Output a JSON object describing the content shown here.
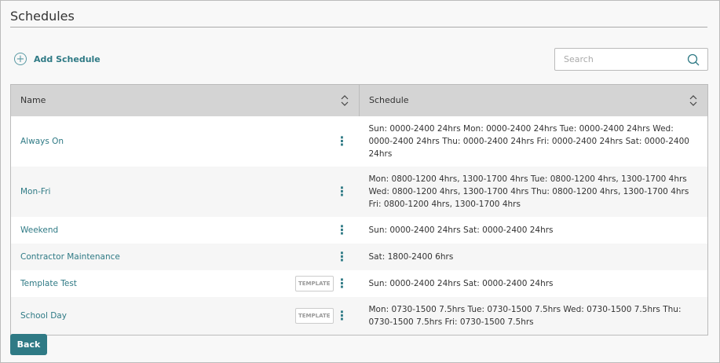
{
  "page": {
    "title": "Schedules"
  },
  "toolbar": {
    "add_label": "Add Schedule",
    "search_placeholder": "Search"
  },
  "table": {
    "headers": {
      "name": "Name",
      "schedule": "Schedule"
    },
    "template_badge": "TEMPLATE",
    "rows": [
      {
        "name": "Always On",
        "template": false,
        "schedule": "Sun: 0000-2400 24hrs Mon: 0000-2400 24hrs Tue: 0000-2400 24hrs Wed: 0000-2400 24hrs Thu: 0000-2400 24hrs Fri: 0000-2400 24hrs Sat: 0000-2400 24hrs"
      },
      {
        "name": "Mon-Fri",
        "template": false,
        "schedule": "Mon: 0800-1200 4hrs, 1300-1700 4hrs Tue: 0800-1200 4hrs, 1300-1700 4hrs Wed: 0800-1200 4hrs, 1300-1700 4hrs Thu: 0800-1200 4hrs, 1300-1700 4hrs Fri: 0800-1200 4hrs, 1300-1700 4hrs"
      },
      {
        "name": "Weekend",
        "template": false,
        "schedule": "Sun: 0000-2400 24hrs Sat: 0000-2400 24hrs"
      },
      {
        "name": "Contractor Maintenance",
        "template": false,
        "schedule": "Sat: 1800-2400 6hrs"
      },
      {
        "name": "Template Test",
        "template": true,
        "schedule": "Sun: 0000-2400 24hrs Sat: 0000-2400 24hrs"
      },
      {
        "name": "School Day",
        "template": true,
        "schedule": "Mon: 0730-1500 7.5hrs Tue: 0730-1500 7.5hrs Wed: 0730-1500 7.5hrs Thu: 0730-1500 7.5hrs Fri: 0730-1500 7.5hrs"
      }
    ]
  },
  "footer": {
    "back_label": "Back"
  },
  "colors": {
    "accent": "#2f7a85",
    "header_bg": "#d4d4d4"
  }
}
